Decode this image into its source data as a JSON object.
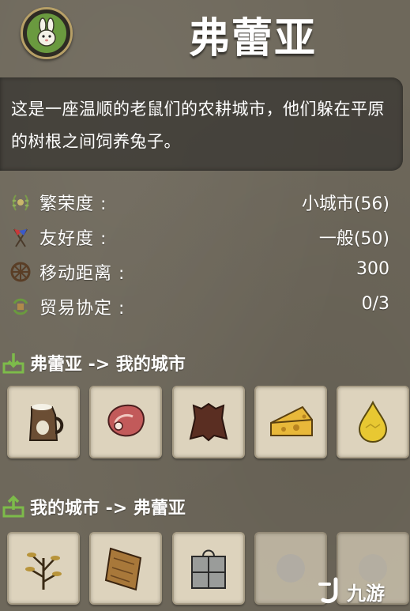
{
  "header": {
    "city_name": "弗蕾亚",
    "emblem_icon": "rabbit-icon"
  },
  "description": "这是一座温顺的老鼠们的农耕城市，他们躲在平原的树根之间饲养兔子。",
  "stats": [
    {
      "icon": "laurel-icon",
      "label": "繁荣度 :",
      "value": "小城市(56)"
    },
    {
      "icon": "flags-icon",
      "label": "友好度 :",
      "value": "一般(50)"
    },
    {
      "icon": "wheel-icon",
      "label": "移动距离 :",
      "value": "300"
    },
    {
      "icon": "trade-cycle-icon",
      "label": "贸易协定 :",
      "value": "0/3"
    }
  ],
  "import_section": {
    "title": "弗蕾亚 -> 我的城市",
    "icon": "download-icon",
    "items": [
      "milk-jug-icon",
      "raw-meat-icon",
      "hide-icon",
      "cheese-icon",
      "honey-drop-icon"
    ]
  },
  "export_section": {
    "title": "我的城市 -> 弗蕾亚",
    "icon": "upload-icon",
    "items": [
      "herb-bundle-icon",
      "wood-plank-icon",
      "stone-bundle-icon",
      "blurred-item-icon",
      "blurred-item-icon"
    ]
  },
  "watermark": {
    "text": "九游",
    "icon": "j-logo-icon"
  },
  "colors": {
    "background": "#6e685b",
    "slot": "#ddd3bd",
    "emblem_ring": "#b7a067",
    "emblem_fill": "#6a9a3f"
  }
}
